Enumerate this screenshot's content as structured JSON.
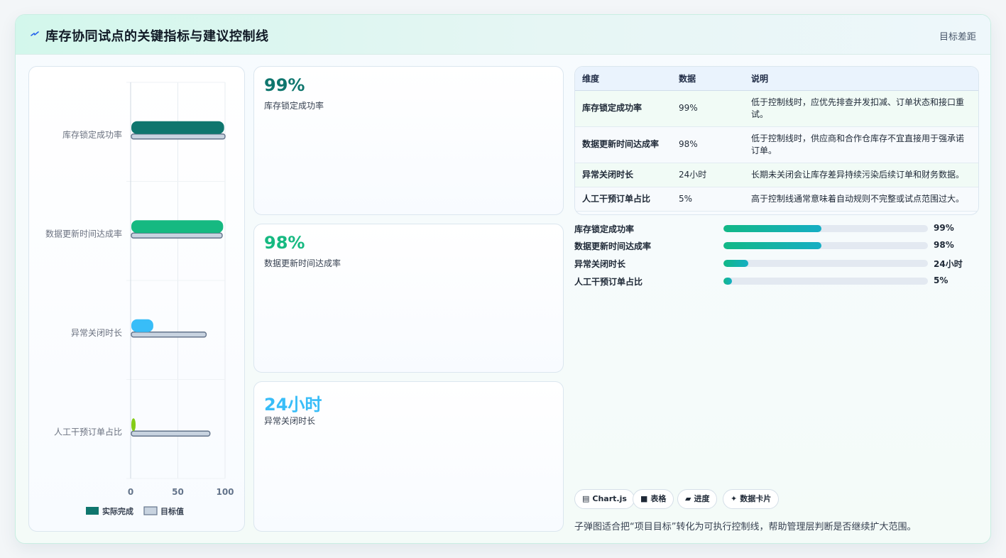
{
  "header": {
    "title": "库存协同试点的关键指标与建议控制线",
    "right_tag": "目标差距"
  },
  "chart_data": {
    "type": "bar",
    "orientation": "horizontal",
    "categories": [
      "库存锁定成功率",
      "数据更新时间达成率",
      "异常关闭时长",
      "人工干预订单占比"
    ],
    "series": [
      {
        "name": "实际完成",
        "values": [
          99,
          98,
          24,
          5
        ],
        "colors": [
          "#0f766e",
          "#16b981",
          "#38bdf8",
          "#84cc16"
        ]
      },
      {
        "name": "目标值",
        "values": [
          100,
          97,
          80,
          84
        ],
        "color": "#c8d3e0"
      }
    ],
    "xlim": [
      0,
      100
    ],
    "x_ticks": [
      "0",
      "50",
      "100"
    ],
    "legend_position": "bottom"
  },
  "kpis": [
    {
      "value": "99%",
      "label": "库存锁定成功率",
      "color": "#0f766e"
    },
    {
      "value": "98%",
      "label": "数据更新时间达成率",
      "color": "#16b981"
    },
    {
      "value": "24小时",
      "label": "异常关闭时长",
      "color": "#38bdf8"
    }
  ],
  "table": {
    "headers": [
      "维度",
      "数据",
      "说明"
    ],
    "rows": [
      {
        "dim": "库存锁定成功率",
        "val": "99%",
        "desc": "低于控制线时，应优先排查并发扣减、订单状态和接口重试。"
      },
      {
        "dim": "数据更新时间达成率",
        "val": "98%",
        "desc": "低于控制线时，供应商和合作仓库存不宜直接用于强承诺订单。"
      },
      {
        "dim": "异常关闭时长",
        "val": "24小时",
        "desc": "长期未关闭会让库存差异持续污染后续订单和财务数据。"
      },
      {
        "dim": "人工干预订单占比",
        "val": "5%",
        "desc": "高于控制线通常意味着自动规则不完整或试点范围过大。"
      }
    ]
  },
  "progress": [
    {
      "label": "库存锁定成功率",
      "value": "99%",
      "fill": 0.48
    },
    {
      "label": "数据更新时间达成率",
      "value": "98%",
      "fill": 0.48
    },
    {
      "label": "异常关闭时长",
      "value": "24小时",
      "fill": 0.12
    },
    {
      "label": "人工干预订单占比",
      "value": "5%",
      "fill": 0.04
    }
  ],
  "chips": [
    {
      "icon": "▤",
      "label": "Chart.js"
    },
    {
      "icon": "■",
      "label": "表格"
    },
    {
      "icon": "▰",
      "label": "进度"
    },
    {
      "icon": "✦",
      "label": "数据卡片"
    }
  ],
  "note": "子弹图适合把“项目目标”转化为可执行控制线，帮助管理层判断是否继续扩大范围。"
}
